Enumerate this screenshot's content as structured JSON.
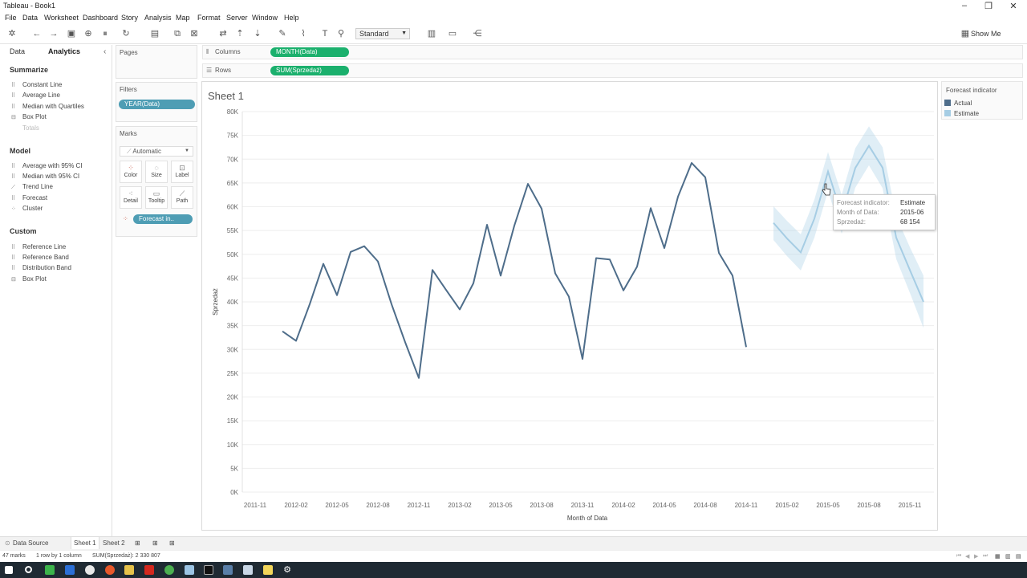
{
  "window": {
    "title": "Tableau - Book1"
  },
  "menu": [
    "File",
    "Data",
    "Worksheet",
    "Dashboard",
    "Story",
    "Analysis",
    "Map",
    "Format",
    "Server",
    "Window",
    "Help"
  ],
  "toolbar": {
    "fit_select": "Standard",
    "show_me": "Show Me"
  },
  "left_pane": {
    "tabs": [
      "Data",
      "Analytics"
    ],
    "sections": [
      {
        "title": "Summarize",
        "items": [
          "Constant Line",
          "Average Line",
          "Median with Quartiles",
          "Box Plot",
          "Totals"
        ]
      },
      {
        "title": "Model",
        "items": [
          "Average with 95% CI",
          "Median with 95% CI",
          "Trend Line",
          "Forecast",
          "Cluster"
        ]
      },
      {
        "title": "Custom",
        "items": [
          "Reference Line",
          "Reference Band",
          "Distribution Band",
          "Box Plot"
        ]
      }
    ]
  },
  "cards": {
    "pages_title": "Pages",
    "filters_title": "Filters",
    "filter_pill": "YEAR(Data)",
    "marks_title": "Marks",
    "marks_type": "Automatic",
    "mark_buttons": [
      "Color",
      "Size",
      "Label",
      "Detail",
      "Tooltip",
      "Path"
    ],
    "marks_pill": "Forecast in.."
  },
  "shelves": {
    "columns_label": "Columns",
    "columns_pill": "MONTH(Data)",
    "rows_label": "Rows",
    "rows_pill": "SUM(Sprzedaż)"
  },
  "sheet": {
    "title": "Sheet 1"
  },
  "legend": {
    "title": "Forecast indicator",
    "items": [
      {
        "label": "Actual",
        "color": "#4e6d8a"
      },
      {
        "label": "Estimate",
        "color": "#a6cde4"
      }
    ]
  },
  "tooltip": {
    "rows": [
      {
        "label": "Forecast indicator:",
        "value": "Estimate"
      },
      {
        "label": "Month of Data:",
        "value": "2015-06"
      },
      {
        "label": "Sprzedaż:",
        "value": "68 154"
      }
    ]
  },
  "chart_data": {
    "type": "line",
    "xlabel": "Month of Data",
    "ylabel": "Sprzedaż",
    "ylim": [
      0,
      80000
    ],
    "y_ticks": [
      "0K",
      "5K",
      "10K",
      "15K",
      "20K",
      "25K",
      "30K",
      "35K",
      "40K",
      "45K",
      "50K",
      "55K",
      "60K",
      "65K",
      "70K",
      "75K",
      "80K"
    ],
    "x_ticks": [
      "2011-11",
      "2012-02",
      "2012-05",
      "2012-08",
      "2012-11",
      "2013-02",
      "2013-05",
      "2013-08",
      "2013-11",
      "2014-02",
      "2014-05",
      "2014-08",
      "2014-11",
      "2015-02",
      "2015-05",
      "2015-08",
      "2015-11"
    ],
    "grid": true,
    "series": [
      {
        "name": "Actual",
        "color": "#4e6d8a",
        "start_month": "2012-01",
        "values": [
          33800,
          31800,
          39500,
          48000,
          41400,
          50500,
          51700,
          48500,
          39500,
          31500,
          24000,
          46700,
          42500,
          38400,
          43900,
          56200,
          45500,
          56000,
          64800,
          59600,
          46000,
          41100,
          28000,
          49200,
          48900,
          42400,
          47400,
          59700,
          51300,
          62100,
          69200,
          66200,
          50300,
          45500,
          30500
        ]
      },
      {
        "name": "Estimate",
        "color": "#a6cde4",
        "start_month": "2015-01",
        "values": [
          56600,
          53300,
          50400,
          57500,
          67400,
          58400,
          68154,
          72800,
          68200,
          53500,
          46700,
          40000
        ],
        "upper": [
          60100,
          57000,
          54200,
          61500,
          71500,
          62500,
          72300,
          76900,
          72500,
          58000,
          51500,
          45500
        ],
        "lower": [
          53000,
          49600,
          46600,
          53500,
          63300,
          54300,
          64000,
          68700,
          63900,
          49000,
          41900,
          34500
        ]
      }
    ]
  },
  "sheet_tabs": [
    "Data Source",
    "Sheet 1",
    "Sheet 2"
  ],
  "status": {
    "marks": "47 marks",
    "rows": "1 row by 1 column",
    "sum": "SUM(Sprzedaż): 2 330 807"
  }
}
